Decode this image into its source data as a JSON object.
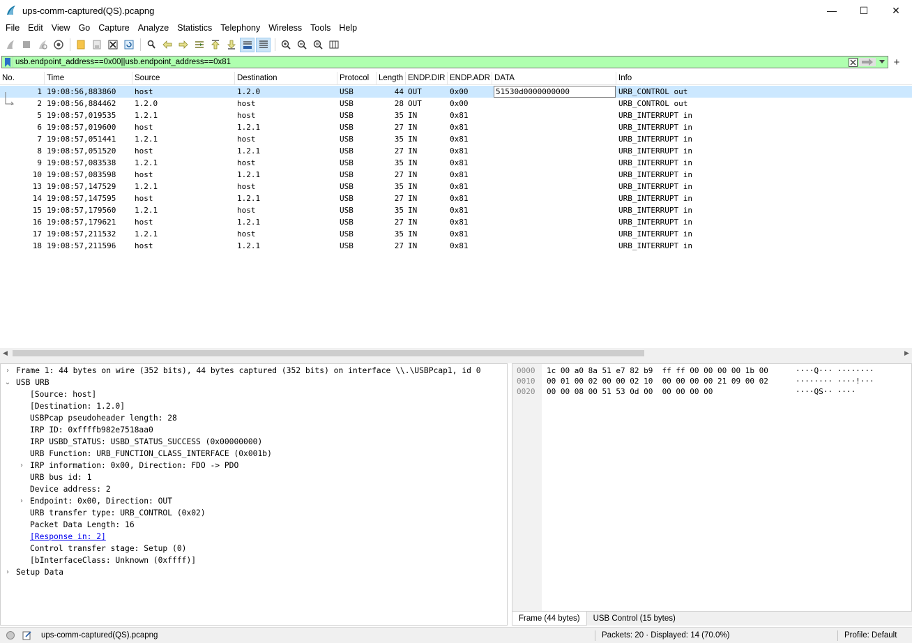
{
  "window": {
    "title": "ups-comm-captured(QS).pcapng",
    "minimize": "—",
    "maximize": "☐",
    "close": "✕"
  },
  "menu": [
    "File",
    "Edit",
    "View",
    "Go",
    "Capture",
    "Analyze",
    "Statistics",
    "Telephony",
    "Wireless",
    "Tools",
    "Help"
  ],
  "filter": {
    "value": "usb.endpoint_address==0x00||usb.endpoint_address==0x81"
  },
  "columns": [
    "No.",
    "Time",
    "Source",
    "Destination",
    "Protocol",
    "Length",
    "ENDP.DIR",
    "ENDP.ADR",
    "DATA",
    "Info"
  ],
  "packets": [
    {
      "no": "1",
      "time": "19:08:56,883860",
      "src": "host",
      "dst": "1.2.0",
      "proto": "USB",
      "len": "44",
      "dir": "OUT",
      "adr": "0x00",
      "data": "51530d0000000000",
      "info": "URB_CONTROL out",
      "selected": true
    },
    {
      "no": "2",
      "time": "19:08:56,884462",
      "src": "1.2.0",
      "dst": "host",
      "proto": "USB",
      "len": "28",
      "dir": "OUT",
      "adr": "0x00",
      "data": "",
      "info": "URB_CONTROL out"
    },
    {
      "no": "5",
      "time": "19:08:57,019535",
      "src": "1.2.1",
      "dst": "host",
      "proto": "USB",
      "len": "35",
      "dir": "IN",
      "adr": "0x81",
      "data": "",
      "info": "URB_INTERRUPT in"
    },
    {
      "no": "6",
      "time": "19:08:57,019600",
      "src": "host",
      "dst": "1.2.1",
      "proto": "USB",
      "len": "27",
      "dir": "IN",
      "adr": "0x81",
      "data": "",
      "info": "URB_INTERRUPT in"
    },
    {
      "no": "7",
      "time": "19:08:57,051441",
      "src": "1.2.1",
      "dst": "host",
      "proto": "USB",
      "len": "35",
      "dir": "IN",
      "adr": "0x81",
      "data": "",
      "info": "URB_INTERRUPT in"
    },
    {
      "no": "8",
      "time": "19:08:57,051520",
      "src": "host",
      "dst": "1.2.1",
      "proto": "USB",
      "len": "27",
      "dir": "IN",
      "adr": "0x81",
      "data": "",
      "info": "URB_INTERRUPT in"
    },
    {
      "no": "9",
      "time": "19:08:57,083538",
      "src": "1.2.1",
      "dst": "host",
      "proto": "USB",
      "len": "35",
      "dir": "IN",
      "adr": "0x81",
      "data": "",
      "info": "URB_INTERRUPT in"
    },
    {
      "no": "10",
      "time": "19:08:57,083598",
      "src": "host",
      "dst": "1.2.1",
      "proto": "USB",
      "len": "27",
      "dir": "IN",
      "adr": "0x81",
      "data": "",
      "info": "URB_INTERRUPT in"
    },
    {
      "no": "13",
      "time": "19:08:57,147529",
      "src": "1.2.1",
      "dst": "host",
      "proto": "USB",
      "len": "35",
      "dir": "IN",
      "adr": "0x81",
      "data": "",
      "info": "URB_INTERRUPT in"
    },
    {
      "no": "14",
      "time": "19:08:57,147595",
      "src": "host",
      "dst": "1.2.1",
      "proto": "USB",
      "len": "27",
      "dir": "IN",
      "adr": "0x81",
      "data": "",
      "info": "URB_INTERRUPT in"
    },
    {
      "no": "15",
      "time": "19:08:57,179560",
      "src": "1.2.1",
      "dst": "host",
      "proto": "USB",
      "len": "35",
      "dir": "IN",
      "adr": "0x81",
      "data": "",
      "info": "URB_INTERRUPT in"
    },
    {
      "no": "16",
      "time": "19:08:57,179621",
      "src": "host",
      "dst": "1.2.1",
      "proto": "USB",
      "len": "27",
      "dir": "IN",
      "adr": "0x81",
      "data": "",
      "info": "URB_INTERRUPT in"
    },
    {
      "no": "17",
      "time": "19:08:57,211532",
      "src": "1.2.1",
      "dst": "host",
      "proto": "USB",
      "len": "35",
      "dir": "IN",
      "adr": "0x81",
      "data": "",
      "info": "URB_INTERRUPT in"
    },
    {
      "no": "18",
      "time": "19:08:57,211596",
      "src": "host",
      "dst": "1.2.1",
      "proto": "USB",
      "len": "27",
      "dir": "IN",
      "adr": "0x81",
      "data": "",
      "info": "URB_INTERRUPT in"
    }
  ],
  "details": [
    {
      "text": "Frame 1: 44 bytes on wire (352 bits), 44 bytes captured (352 bits) on interface \\\\.\\USBPcap1, id 0",
      "level": 0,
      "expander": "collapsed"
    },
    {
      "text": "USB URB",
      "level": 0,
      "expander": "expanded"
    },
    {
      "text": "[Source: host]",
      "level": 1,
      "expander": "none"
    },
    {
      "text": "[Destination: 1.2.0]",
      "level": 1,
      "expander": "none"
    },
    {
      "text": "USBPcap pseudoheader length: 28",
      "level": 1,
      "expander": "none"
    },
    {
      "text": "IRP ID: 0xffffb982e7518aa0",
      "level": 1,
      "expander": "none"
    },
    {
      "text": "IRP USBD_STATUS: USBD_STATUS_SUCCESS (0x00000000)",
      "level": 1,
      "expander": "none"
    },
    {
      "text": "URB Function: URB_FUNCTION_CLASS_INTERFACE (0x001b)",
      "level": 1,
      "expander": "none"
    },
    {
      "text": "IRP information: 0x00, Direction: FDO -> PDO",
      "level": 1,
      "expander": "collapsed"
    },
    {
      "text": "URB bus id: 1",
      "level": 1,
      "expander": "none"
    },
    {
      "text": "Device address: 2",
      "level": 1,
      "expander": "none"
    },
    {
      "text": "Endpoint: 0x00, Direction: OUT",
      "level": 1,
      "expander": "collapsed"
    },
    {
      "text": "URB transfer type: URB_CONTROL (0x02)",
      "level": 1,
      "expander": "none"
    },
    {
      "text": "Packet Data Length: 16",
      "level": 1,
      "expander": "none"
    },
    {
      "text": "[Response in: 2]",
      "level": 1,
      "expander": "none",
      "link": true
    },
    {
      "text": "Control transfer stage: Setup (0)",
      "level": 1,
      "expander": "none"
    },
    {
      "text": "[bInterfaceClass: Unknown (0xffff)]",
      "level": 1,
      "expander": "none"
    },
    {
      "text": "Setup Data",
      "level": 0,
      "expander": "collapsed"
    }
  ],
  "bytes": [
    {
      "offset": "0000",
      "hex": "1c 00 a0 8a 51 e7 82 b9  ff ff 00 00 00 00 1b 00",
      "ascii": "····Q··· ········"
    },
    {
      "offset": "0010",
      "hex": "00 01 00 02 00 00 02 10  00 00 00 00 21 09 00 02",
      "ascii": "········ ····!···"
    },
    {
      "offset": "0020",
      "hex": "00 00 08 00 51 53 0d 00  00 00 00 00",
      "ascii": "····QS·· ····"
    }
  ],
  "byte_tabs": [
    "Frame (44 bytes)",
    "USB Control (15 bytes)"
  ],
  "status": {
    "file": "ups-comm-captured(QS).pcapng",
    "counts": "Packets: 20 · Displayed: 14 (70.0%)",
    "profile": "Profile: Default"
  },
  "colors": {
    "filter_valid": "#afffaf",
    "selected_row": "#cce8ff",
    "link": "#0000ee"
  }
}
